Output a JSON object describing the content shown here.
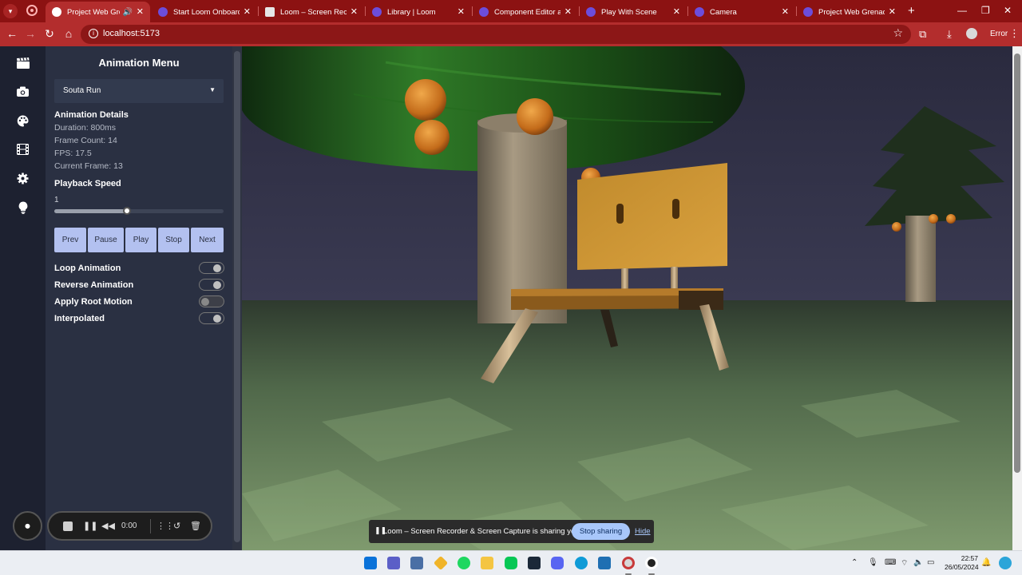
{
  "browser": {
    "tabs": [
      {
        "title": "Project Web Grenade",
        "active": true,
        "favicon": "white-circle-icon",
        "audio": true
      },
      {
        "title": "Start Loom Onboarding",
        "favicon": "loom-icon"
      },
      {
        "title": "Loom – Screen Recorder",
        "favicon": "page-icon"
      },
      {
        "title": "Library | Loom",
        "favicon": "loom-icon"
      },
      {
        "title": "Component Editor and S",
        "favicon": "loom-icon"
      },
      {
        "title": "Play With Scene",
        "favicon": "loom-icon"
      },
      {
        "title": "Camera",
        "favicon": "loom-icon"
      },
      {
        "title": "Project Web Grenade La",
        "favicon": "loom-icon"
      }
    ],
    "url": "localhost:5173",
    "profile_status": "Error",
    "accent": "#b32d2d"
  },
  "sidebar_icons": [
    "clapperboard-icon",
    "camera-icon",
    "palette-icon",
    "film-icon",
    "gear-icon",
    "lightbulb-icon"
  ],
  "panel": {
    "title": "Animation Menu",
    "selected_animation": "Souta Run",
    "details_heading": "Animation Details",
    "duration": "Duration: 800ms",
    "frame_count": "Frame Count: 14",
    "fps": "FPS: 17.5",
    "current_frame": "Current Frame: 13",
    "speed_heading": "Playback Speed",
    "speed_value": "1",
    "speed_fraction": 0.43,
    "buttons": {
      "prev": "Prev",
      "pause": "Pause",
      "play": "Play",
      "stop": "Stop",
      "next": "Next"
    },
    "toggles": [
      {
        "label": "Loop Animation",
        "on": true
      },
      {
        "label": "Reverse Animation",
        "on": true
      },
      {
        "label": "Apply Root Motion",
        "on": false
      },
      {
        "label": "Interpolated",
        "on": true
      }
    ]
  },
  "loom": {
    "time": "0:00",
    "share_message": "Loom – Screen Recorder & Screen Capture is sharing your screen.",
    "stop_sharing": "Stop sharing",
    "hide": "Hide"
  },
  "taskbar": {
    "time": "22:57",
    "date": "26/05/2024"
  }
}
